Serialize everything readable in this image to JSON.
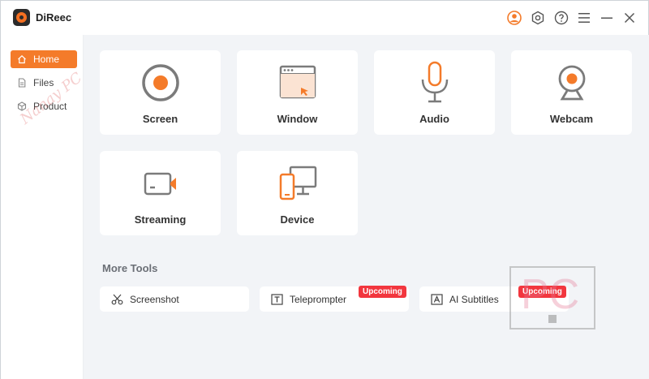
{
  "app": {
    "title": "DiReec"
  },
  "sidebar": {
    "items": [
      {
        "label": "Home",
        "icon": "home-icon",
        "active": true
      },
      {
        "label": "Files",
        "icon": "file-icon",
        "active": false
      },
      {
        "label": "Product",
        "icon": "cube-icon",
        "active": false
      }
    ]
  },
  "cards": [
    {
      "label": "Screen",
      "icon": "record-icon"
    },
    {
      "label": "Window",
      "icon": "window-icon"
    },
    {
      "label": "Audio",
      "icon": "microphone-icon"
    },
    {
      "label": "Webcam",
      "icon": "webcam-icon"
    },
    {
      "label": "Streaming",
      "icon": "streaming-camera-icon"
    },
    {
      "label": "Device",
      "icon": "device-icon"
    }
  ],
  "more_tools": {
    "title": "More Tools",
    "items": [
      {
        "label": "Screenshot",
        "icon": "scissors-icon",
        "badge": ""
      },
      {
        "label": "Teleprompter",
        "icon": "text-box-icon",
        "badge": "Upcoming"
      },
      {
        "label": "AI Subtitles",
        "icon": "subtitle-box-icon",
        "badge": "Upcoming"
      }
    ]
  },
  "watermark": {
    "text": "Nanay PC",
    "box_text": "PC"
  },
  "colors": {
    "accent": "#f47b2a",
    "badge": "#f2363e",
    "background": "#f2f4f7"
  }
}
